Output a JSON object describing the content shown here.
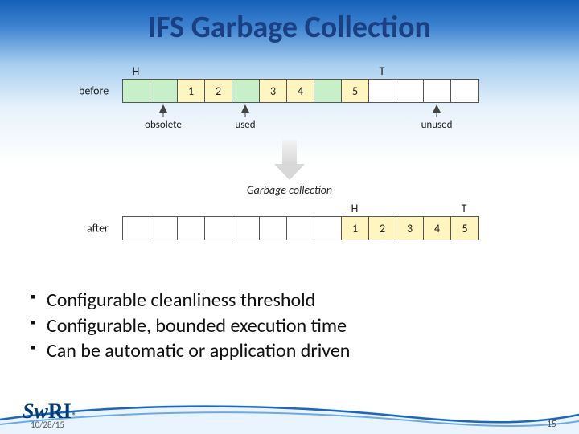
{
  "title": "IFS Garbage Collection",
  "diagram": {
    "pointers": {
      "H": "H",
      "T": "T"
    },
    "before_label": "before",
    "after_label": "after",
    "before_cells": [
      {
        "v": "",
        "cls": "g"
      },
      {
        "v": "",
        "cls": "g"
      },
      {
        "v": "1",
        "cls": "y"
      },
      {
        "v": "2",
        "cls": "y"
      },
      {
        "v": "",
        "cls": "g"
      },
      {
        "v": "3",
        "cls": "y"
      },
      {
        "v": "4",
        "cls": "y"
      },
      {
        "v": "",
        "cls": "g"
      },
      {
        "v": "5",
        "cls": "y"
      },
      {
        "v": "",
        "cls": ""
      },
      {
        "v": "",
        "cls": ""
      },
      {
        "v": "",
        "cls": ""
      },
      {
        "v": "",
        "cls": ""
      }
    ],
    "after_cells": [
      {
        "v": "",
        "cls": ""
      },
      {
        "v": "",
        "cls": ""
      },
      {
        "v": "",
        "cls": ""
      },
      {
        "v": "",
        "cls": ""
      },
      {
        "v": "",
        "cls": ""
      },
      {
        "v": "",
        "cls": ""
      },
      {
        "v": "",
        "cls": ""
      },
      {
        "v": "",
        "cls": ""
      },
      {
        "v": "1",
        "cls": "y"
      },
      {
        "v": "2",
        "cls": "y"
      },
      {
        "v": "3",
        "cls": "y"
      },
      {
        "v": "4",
        "cls": "y"
      },
      {
        "v": "5",
        "cls": "y"
      }
    ],
    "annot_obsolete": "obsolete",
    "annot_used": "used",
    "annot_unused": "unused",
    "gc_label": "Garbage collection"
  },
  "bullets": [
    "Configurable cleanliness threshold",
    "Configurable, bounded execution time",
    "Can be automatic or application driven"
  ],
  "footer": {
    "logo_sw": "Sw",
    "logo_ri": "RI",
    "reg": "®",
    "date": "10/28/15",
    "page": "15"
  }
}
